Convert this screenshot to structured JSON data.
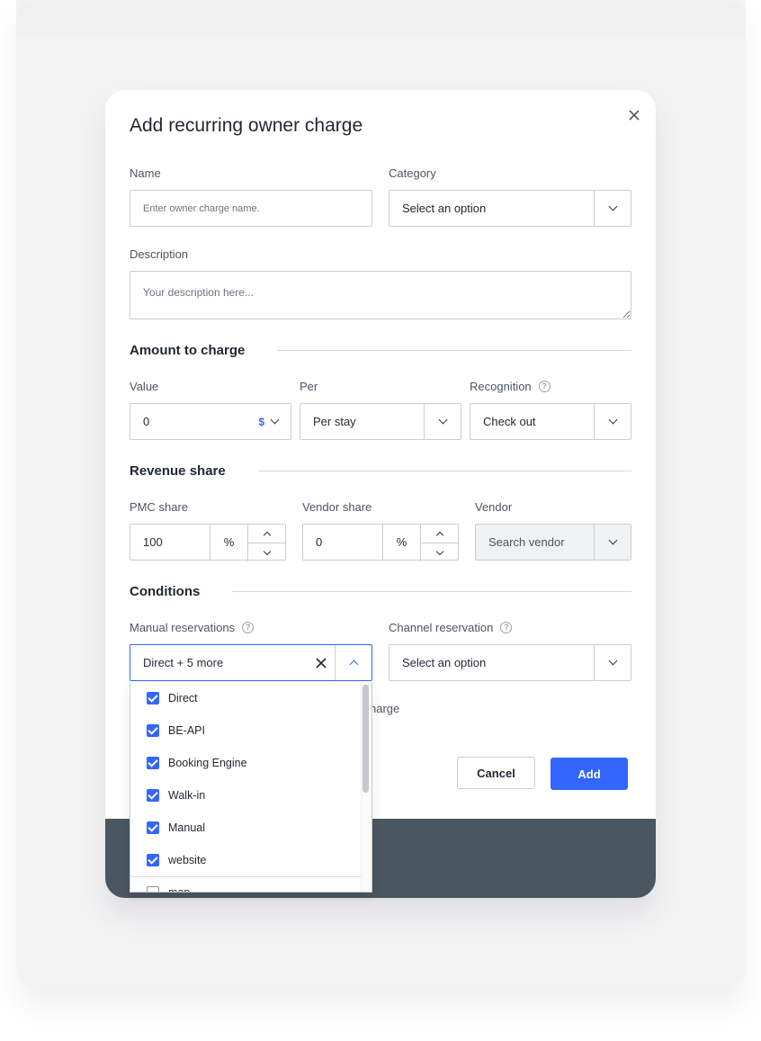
{
  "modal": {
    "title": "Add recurring owner charge"
  },
  "name": {
    "label": "Name",
    "placeholder": "Enter owner charge name."
  },
  "category": {
    "label": "Category",
    "value": "Select an option"
  },
  "description": {
    "label": "Description",
    "placeholder": "Your description here..."
  },
  "amount": {
    "heading": "Amount to charge",
    "value_label": "Value",
    "value": "0",
    "currency": "$",
    "per_label": "Per",
    "per_value": "Per stay",
    "recognition_label": "Recognition",
    "recognition_value": "Check out"
  },
  "revenue": {
    "heading": "Revenue share",
    "pmc_label": "PMC share",
    "pmc_value": "100",
    "pmc_unit": "%",
    "vendor_share_label": "Vendor share",
    "vendor_share_value": "0",
    "vendor_share_unit": "%",
    "vendor_label": "Vendor",
    "vendor_value": "Search vendor"
  },
  "conditions": {
    "heading": "Conditions",
    "manual_label": "Manual reservations",
    "manual_value": "Direct + 5 more",
    "channel_label": "Channel reservation",
    "channel_value": "Select an option",
    "hidden_text": "harge"
  },
  "dropdown": {
    "items": [
      {
        "label": "Direct",
        "checked": true
      },
      {
        "label": "BE-API",
        "checked": true
      },
      {
        "label": "Booking Engine",
        "checked": true
      },
      {
        "label": "Walk-in",
        "checked": true
      },
      {
        "label": "Manual",
        "checked": true
      },
      {
        "label": "website",
        "checked": true
      },
      {
        "label": "man",
        "checked": false
      }
    ]
  },
  "buttons": {
    "cancel": "Cancel",
    "add": "Add"
  },
  "colors": {
    "accent": "#3366ff",
    "footer": "#4a5660"
  }
}
